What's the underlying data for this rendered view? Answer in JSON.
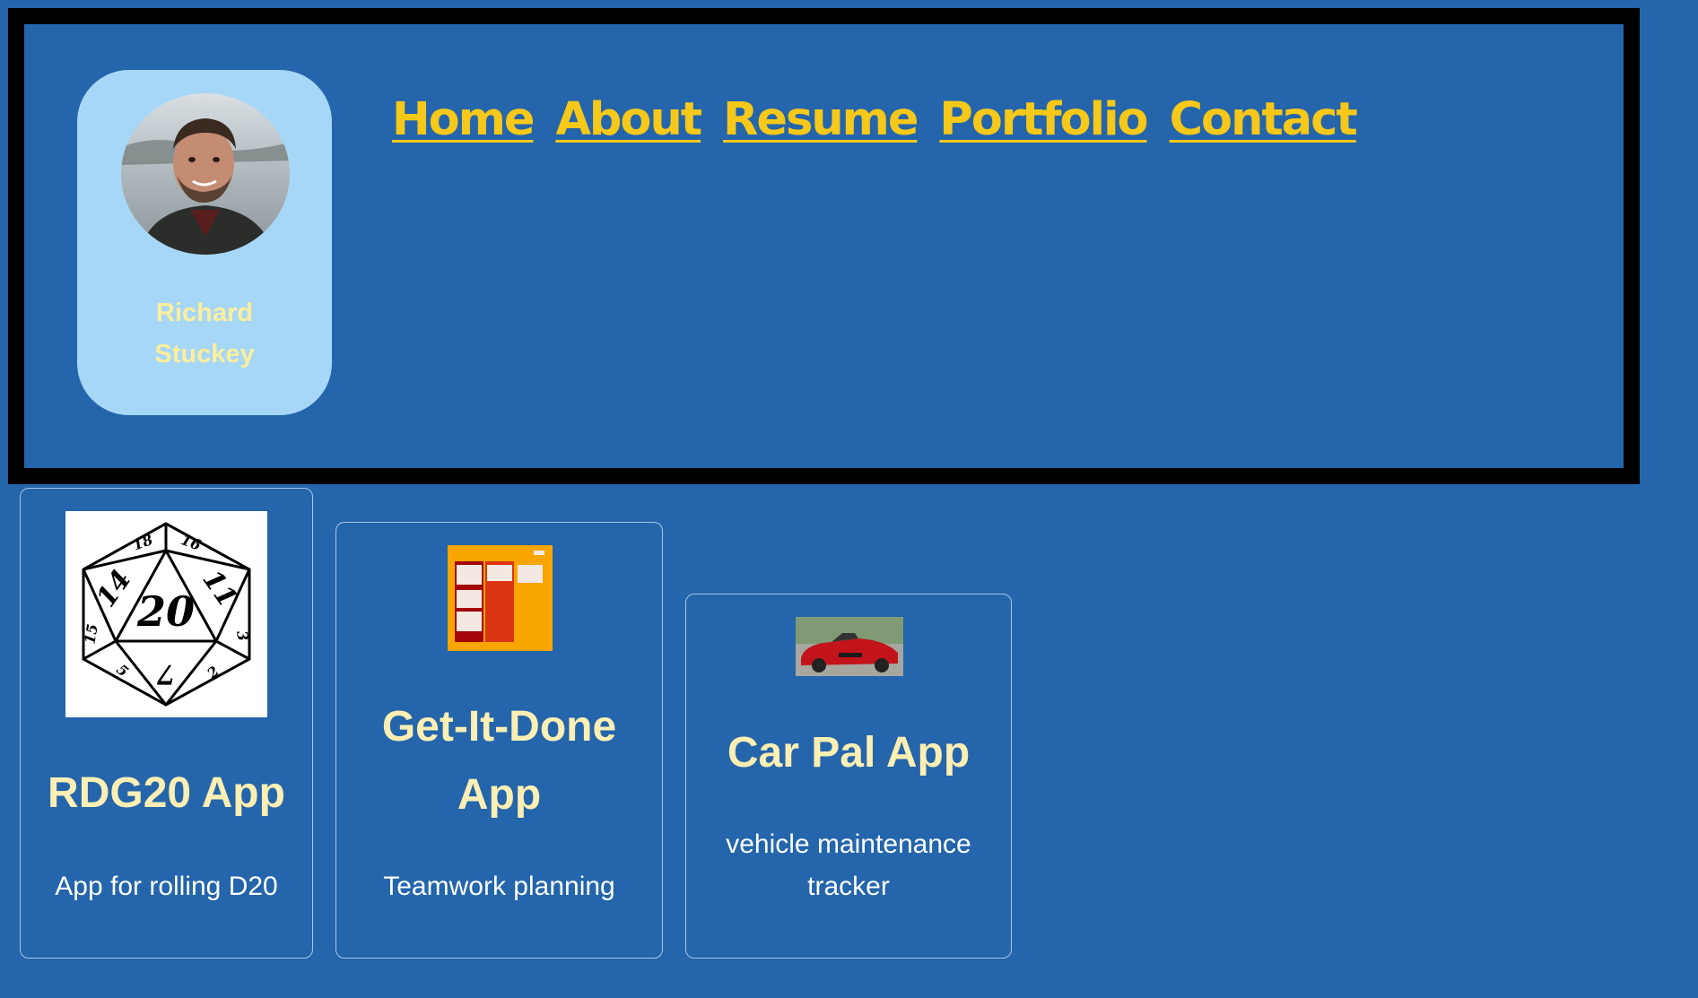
{
  "profile": {
    "name_line1": "Richard",
    "name_line2": "Stuckey"
  },
  "nav": {
    "items": [
      {
        "label": "Home"
      },
      {
        "label": "About"
      },
      {
        "label": "Resume"
      },
      {
        "label": "Portfolio"
      },
      {
        "label": "Contact"
      }
    ]
  },
  "projects": [
    {
      "title": "RDG20 App",
      "description": "App for rolling D20",
      "image_icon": "d20-die-icon",
      "d20_faces": [
        "18",
        "16",
        "14",
        "20",
        "11",
        "15",
        "3",
        "7",
        "5",
        "2"
      ]
    },
    {
      "title": "Get-It-Done App",
      "description": "Teamwork planning",
      "image_icon": "kanban-board-thumbnail"
    },
    {
      "title": "Car Pal App",
      "description": "vehicle maintenance tracker",
      "image_icon": "red-convertible-car-thumbnail"
    }
  ],
  "colors": {
    "background": "#2465ab",
    "header_border": "#000000",
    "profile_card": "#a7d7f7",
    "nav_link": "#f5c81a",
    "card_title": "#fbefb4",
    "profile_name": "#fbef9c"
  }
}
